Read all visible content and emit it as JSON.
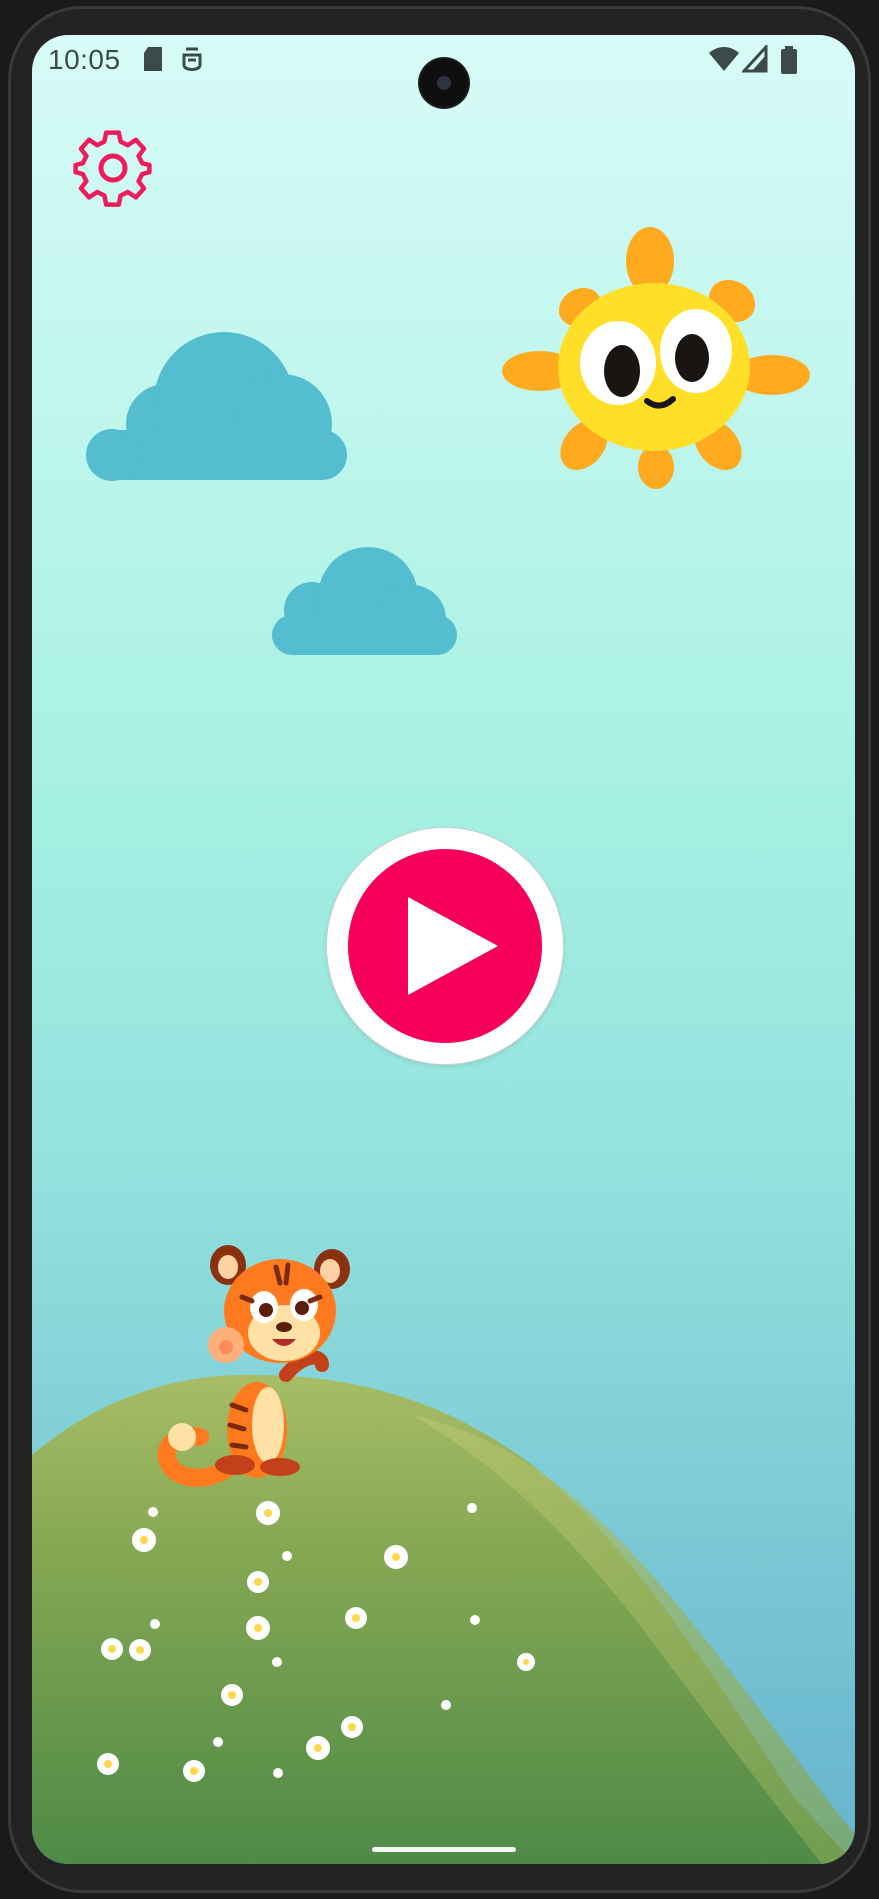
{
  "status_bar": {
    "time": "10:05",
    "left_icons": [
      "sd-card-icon",
      "debug-icon"
    ],
    "right_icons": [
      "wifi-icon",
      "cell-signal-icon",
      "battery-icon"
    ]
  },
  "top": {
    "settings_icon": "gear-icon"
  },
  "main": {
    "play_icon": "play-icon"
  },
  "scene": {
    "sun": "sun-character",
    "clouds": [
      "cloud",
      "cloud"
    ],
    "mascot": "tiger-mascot",
    "hill": "grassy-hill-with-flowers"
  },
  "colors": {
    "accent": "#f5005a",
    "sky_top": "#d8fbf7",
    "sky_mid": "#a8f1e3",
    "sky_bottom": "#66b3cd",
    "cloud": "#55bdd0",
    "sun": "#ffdf28",
    "sun_rays": "#ffaa1f",
    "hill": "#6b9e4f"
  }
}
